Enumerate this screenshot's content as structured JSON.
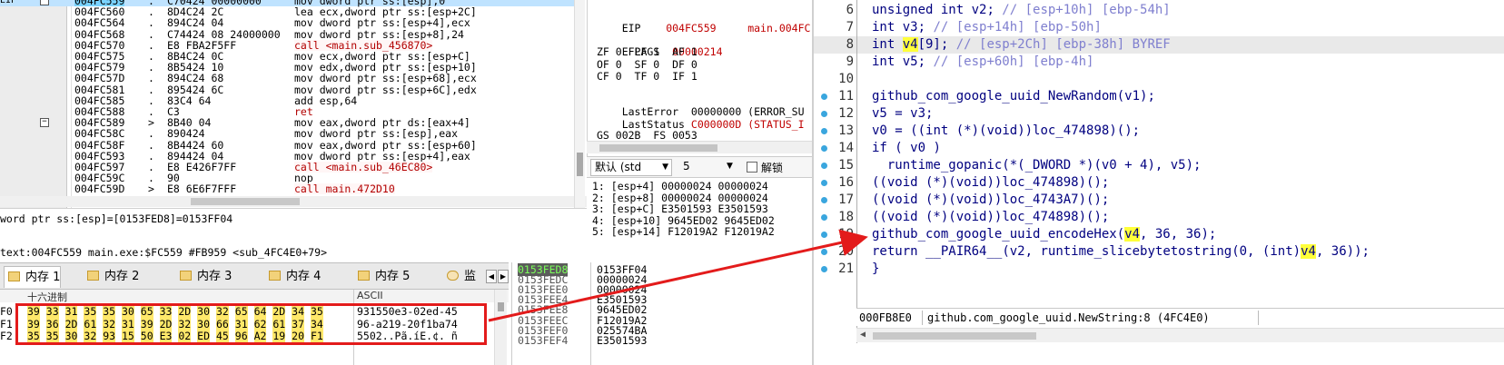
{
  "disasm": {
    "rows": [
      {
        "ip": "EIP",
        "addr": "004FC559",
        "bar": ".",
        "hex": "C70424 00000000",
        "ins": "mov dword ptr ss:[esp],0",
        "kind": "sel"
      },
      {
        "ip": "",
        "addr": "004FC560",
        "bar": ".",
        "hex": "8D4C24 2C",
        "ins": "lea ecx,dword ptr ss:[esp+2C]",
        "kind": ""
      },
      {
        "ip": "",
        "addr": "004FC564",
        "bar": ".",
        "hex": "894C24 04",
        "ins": "mov dword ptr ss:[esp+4],ecx",
        "kind": ""
      },
      {
        "ip": "",
        "addr": "004FC568",
        "bar": ".",
        "hex": "C74424 08 24000000",
        "ins": "mov dword ptr ss:[esp+8],24",
        "kind": ""
      },
      {
        "ip": "",
        "addr": "004FC570",
        "bar": ".",
        "hex": "E8 FBA2F5FF",
        "ins": "call <main.sub_456870>",
        "kind": "call"
      },
      {
        "ip": "",
        "addr": "004FC575",
        "bar": ".",
        "hex": "8B4C24 0C",
        "ins": "mov ecx,dword ptr ss:[esp+C]",
        "kind": ""
      },
      {
        "ip": "",
        "addr": "004FC579",
        "bar": ".",
        "hex": "8B5424 10",
        "ins": "mov edx,dword ptr ss:[esp+10]",
        "kind": ""
      },
      {
        "ip": "",
        "addr": "004FC57D",
        "bar": ".",
        "hex": "894C24 68",
        "ins": "mov dword ptr ss:[esp+68],ecx",
        "kind": ""
      },
      {
        "ip": "",
        "addr": "004FC581",
        "bar": ".",
        "hex": "895424 6C",
        "ins": "mov dword ptr ss:[esp+6C],edx",
        "kind": ""
      },
      {
        "ip": "",
        "addr": "004FC585",
        "bar": ".",
        "hex": "83C4 64",
        "ins": "add esp,64",
        "kind": ""
      },
      {
        "ip": "",
        "addr": "004FC588",
        "bar": ".",
        "hex": "C3",
        "ins": "ret",
        "kind": "ret"
      },
      {
        "ip": "",
        "addr": "004FC589",
        "bar": ">",
        "hex": "8B40 04",
        "ins": "mov eax,dword ptr ds:[eax+4]",
        "kind": ""
      },
      {
        "ip": "",
        "addr": "004FC58C",
        "bar": ".",
        "hex": "890424",
        "ins": "mov dword ptr ss:[esp],eax",
        "kind": ""
      },
      {
        "ip": "",
        "addr": "004FC58F",
        "bar": ".",
        "hex": "8B4424 60",
        "ins": "mov eax,dword ptr ss:[esp+60]",
        "kind": ""
      },
      {
        "ip": "",
        "addr": "004FC593",
        "bar": ".",
        "hex": "894424 04",
        "ins": "mov dword ptr ss:[esp+4],eax",
        "kind": ""
      },
      {
        "ip": "",
        "addr": "004FC597",
        "bar": ".",
        "hex": "E8 E426F7FF",
        "ins": "call <main.sub_46EC80>",
        "kind": "call"
      },
      {
        "ip": "",
        "addr": "004FC59C",
        "bar": ".",
        "hex": "90",
        "ins": "nop",
        "kind": ""
      },
      {
        "ip": "",
        "addr": "004FC59D",
        "bar": ">",
        "hex": "E8 6E6F7FFF",
        "ins": "call main.472D10",
        "kind": "call"
      }
    ],
    "info_line1": "word ptr ss:[esp]=[0153FED8]=0153FF04",
    "info_line2": "text:004FC559 main.exe:$FC559 #FB959 <sub_4FC4E0+79>"
  },
  "registers": {
    "eip_label": "EIP",
    "eip_value": "004FC559",
    "eip_symbol": "main.004FC",
    "eflags_label": "EFLAGS",
    "eflags_value": "00000214",
    "flags_row1": "ZF 0  PF 1  AF 1",
    "flags_row2": "OF 0  SF 0  DF 0",
    "flags_row3": "CF 0  TF 0  IF 1",
    "lasterror_label": "LastError",
    "lasterror_value": "00000000 (ERROR_SU",
    "laststatus_label": "LastStatus",
    "laststatus_value": "C000000D (STATUS_I",
    "seg_row": "GS 002B  FS 0053"
  },
  "args_toolbar": {
    "convention": "默认 (std",
    "count": "5",
    "lock_label": "解锁"
  },
  "args": [
    "1: [esp+4] 00000024 00000024",
    "2: [esp+8] 00000024 00000024",
    "3: [esp+C] E3501593 E3501593",
    "4: [esp+10] 9645ED02 9645ED02",
    "5: [esp+14] F12019A2 F12019A2"
  ],
  "memory_tabs": [
    {
      "label": "内存 1",
      "active": true
    },
    {
      "label": "内存 2",
      "active": false
    },
    {
      "label": "内存 3",
      "active": false
    },
    {
      "label": "内存 4",
      "active": false
    },
    {
      "label": "内存 5",
      "active": false
    },
    {
      "label": "监",
      "active": false,
      "icon": "cat"
    }
  ],
  "memory": {
    "header_hex": "十六进制",
    "header_ascii": "ASCII",
    "rows": [
      {
        "addr": "F0",
        "hex": "39 33 31 35 35 30 65 33 2D 30 32 65 64 2D 34 35",
        "ascii": "931550e3-02ed-45"
      },
      {
        "addr": "F1",
        "hex": "39 36 2D 61 32 31 39 2D 32 30 66 31 62 61 37 34",
        "ascii": "96-a219-20f1ba74"
      },
      {
        "addr": "F2",
        "hex": "35 35 30 32 93 15 50 E3 02 ED 45 96 A2 19 20 F1",
        "ascii": "5502..Pã.íE.¢. ñ"
      }
    ]
  },
  "stack": {
    "rows": [
      {
        "addr": "0153FED8",
        "value": "0153FF04",
        "selected": true
      },
      {
        "addr": "0153FEDC",
        "value": "00000024",
        "selected": false
      },
      {
        "addr": "0153FEE0",
        "value": "00000024",
        "selected": false
      },
      {
        "addr": "0153FEE4",
        "value": "E3501593",
        "selected": false
      },
      {
        "addr": "0153FEE8",
        "value": "9645ED02",
        "selected": false
      },
      {
        "addr": "0153FEEC",
        "value": "F12019A2",
        "selected": false
      },
      {
        "addr": "0153FEF0",
        "value": "025574BA",
        "selected": false
      },
      {
        "addr": "0153FEF4",
        "value": "E3501593",
        "selected": false
      }
    ]
  },
  "pseudocode": {
    "current_line": 8,
    "lines": [
      {
        "n": "6",
        "dot": false,
        "parts": [
          [
            "kw",
            "unsigned int "
          ],
          [
            "var",
            "v2"
          ],
          [
            "",
            "; "
          ],
          [
            "cmt",
            "// [esp+10h] [ebp-54h]"
          ]
        ]
      },
      {
        "n": "7",
        "dot": false,
        "parts": [
          [
            "kw",
            "int "
          ],
          [
            "var",
            "v3"
          ],
          [
            "",
            "; "
          ],
          [
            "cmt",
            "// [esp+14h] [ebp-50h]"
          ]
        ]
      },
      {
        "n": "8",
        "dot": false,
        "parts": [
          [
            "kw",
            "int "
          ],
          [
            "hlv",
            "v4"
          ],
          [
            "",
            "[9]; "
          ],
          [
            "cmt",
            "// [esp+2Ch] [ebp-38h] BYREF"
          ]
        ]
      },
      {
        "n": "9",
        "dot": false,
        "parts": [
          [
            "kw",
            "int "
          ],
          [
            "var",
            "v5"
          ],
          [
            "",
            "; "
          ],
          [
            "cmt",
            "// [esp+60h] [ebp-4h]"
          ]
        ]
      },
      {
        "n": "10",
        "dot": false,
        "parts": []
      },
      {
        "n": "11",
        "dot": true,
        "parts": [
          [
            "fn",
            "github_com_google_uuid_NewRandom"
          ],
          [
            "",
            "("
          ],
          [
            "var",
            "v1"
          ],
          [
            "",
            ");"
          ]
        ]
      },
      {
        "n": "12",
        "dot": true,
        "parts": [
          [
            "var",
            "v5"
          ],
          [
            "",
            " = "
          ],
          [
            "var",
            "v3"
          ],
          [
            "",
            ";"
          ]
        ]
      },
      {
        "n": "13",
        "dot": true,
        "parts": [
          [
            "var",
            "v0"
          ],
          [
            "",
            " = (("
          ],
          [
            "kw",
            "int"
          ],
          [
            "",
            " (*)("
          ],
          [
            "kw",
            "void"
          ],
          [
            "",
            "))"
          ],
          [
            "fn",
            "loc_474898"
          ],
          [
            "",
            ")();"
          ]
        ]
      },
      {
        "n": "14",
        "dot": true,
        "parts": [
          [
            "kw",
            "if"
          ],
          [
            "",
            " ( "
          ],
          [
            "var",
            "v0"
          ],
          [
            "",
            " )"
          ]
        ]
      },
      {
        "n": "15",
        "dot": true,
        "parts": [
          [
            "",
            "  "
          ],
          [
            "fn",
            "runtime_gopanic"
          ],
          [
            "",
            "(*(_DWORD *)("
          ],
          [
            "var",
            "v0"
          ],
          [
            "",
            " + 4), "
          ],
          [
            "var",
            "v5"
          ],
          [
            "",
            ");"
          ]
        ]
      },
      {
        "n": "16",
        "dot": true,
        "parts": [
          [
            "",
            "(("
          ],
          [
            "kw",
            "void"
          ],
          [
            "",
            " (*)("
          ],
          [
            "kw",
            "void"
          ],
          [
            "",
            "))"
          ],
          [
            "fn",
            "loc_474898"
          ],
          [
            "",
            ")();"
          ]
        ]
      },
      {
        "n": "17",
        "dot": true,
        "parts": [
          [
            "",
            "(("
          ],
          [
            "kw",
            "void"
          ],
          [
            "",
            " (*)("
          ],
          [
            "kw",
            "void"
          ],
          [
            "",
            "))"
          ],
          [
            "fn",
            "loc_4743A7"
          ],
          [
            "",
            ")();"
          ]
        ]
      },
      {
        "n": "18",
        "dot": true,
        "parts": [
          [
            "",
            "(("
          ],
          [
            "kw",
            "void"
          ],
          [
            "",
            " (*)("
          ],
          [
            "kw",
            "void"
          ],
          [
            "",
            "))"
          ],
          [
            "fn",
            "loc_474898"
          ],
          [
            "",
            ")();"
          ]
        ]
      },
      {
        "n": "19",
        "dot": true,
        "parts": [
          [
            "fn",
            "github_com_google_uuid_encodeHex"
          ],
          [
            "",
            "("
          ],
          [
            "hlv",
            "v4"
          ],
          [
            "",
            ", 36, 36);"
          ]
        ]
      },
      {
        "n": "20",
        "dot": true,
        "parts": [
          [
            "kw",
            "return "
          ],
          [
            "fn",
            "__PAIR64__"
          ],
          [
            "",
            "("
          ],
          [
            "var",
            "v2"
          ],
          [
            "",
            ", "
          ],
          [
            "fn",
            "runtime_slicebytetostring"
          ],
          [
            "",
            "(0, ("
          ],
          [
            "kw",
            "int"
          ],
          [
            "",
            ")"
          ],
          [
            "hlv",
            "v4"
          ],
          [
            "",
            ", 36));"
          ]
        ]
      },
      {
        "n": "21",
        "dot": true,
        "parts": [
          [
            "",
            "}"
          ]
        ]
      }
    ]
  },
  "code_status": {
    "address": "000FB8E0",
    "function": "github.com_google_uuid.NewString:8 (4FC4E0)"
  },
  "colors": {
    "annotation_red": "#e31b1b",
    "highlight_yellow": "#ffff3a",
    "selection_blue": "#bfe3ff"
  }
}
